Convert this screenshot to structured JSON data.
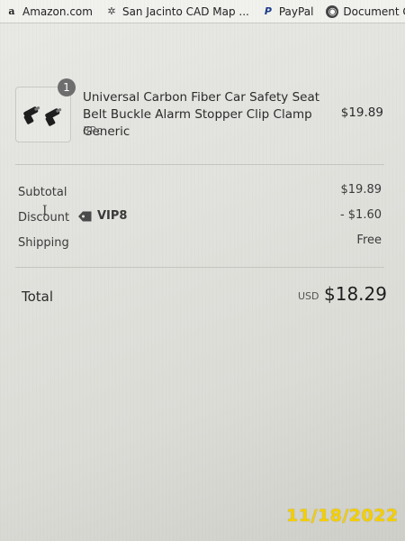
{
  "bookmarks": [
    {
      "label": "Amazon.com",
      "icon": "amazon-icon"
    },
    {
      "label": "San Jacinto CAD Map ...",
      "icon": "gear-icon"
    },
    {
      "label": "PayPal",
      "icon": "paypal-icon"
    },
    {
      "label": "Document Center",
      "icon": "document-icon"
    }
  ],
  "product": {
    "quantity": "1",
    "title": "Universal Carbon Fiber Car Safety Seat Belt Buckle Alarm Stopper Clip Clamp Generic",
    "variant": "3Pc",
    "price": "$19.89"
  },
  "summary": {
    "subtotal_label": "Subtotal",
    "subtotal_value": "$19.89",
    "discount_label": "Discount",
    "discount_code": "VIP8",
    "discount_value": "- $1.60",
    "shipping_label": "Shipping",
    "shipping_value": "Free"
  },
  "total": {
    "label": "Total",
    "currency": "USD",
    "amount": "$18.29"
  },
  "photo_date_stamp": "11/18/2022",
  "colors": {
    "date_stamp": "#f5d000",
    "badge": "#6e6e6e",
    "background": "#e4e4e0"
  }
}
